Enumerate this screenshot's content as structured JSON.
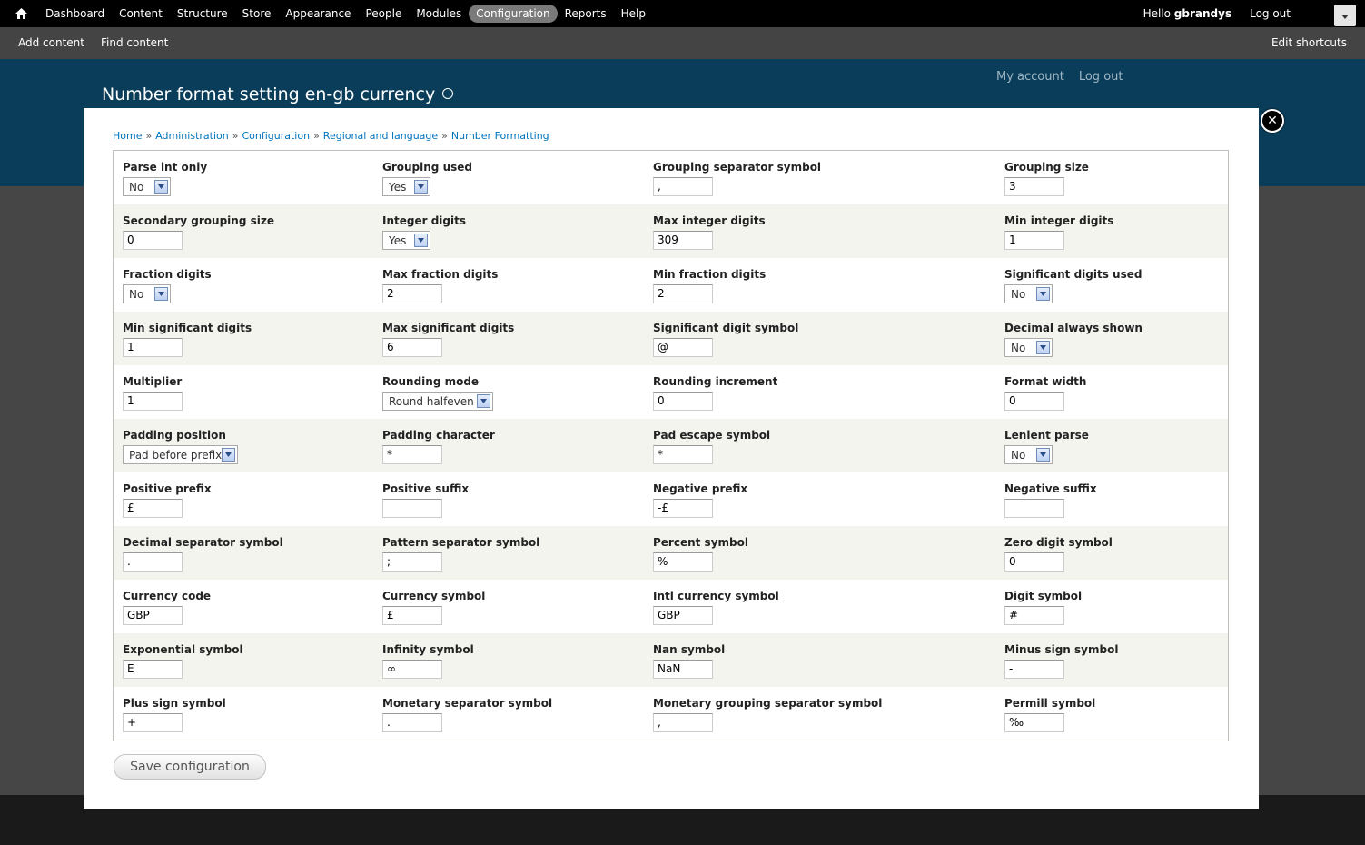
{
  "toolbar": {
    "menu": [
      "Dashboard",
      "Content",
      "Structure",
      "Store",
      "Appearance",
      "People",
      "Modules",
      "Configuration",
      "Reports",
      "Help"
    ],
    "active": "Configuration",
    "hello_prefix": "Hello ",
    "username": "gbrandys",
    "logout": "Log out"
  },
  "shortcuts": {
    "links": [
      "Add content",
      "Find content"
    ],
    "edit": "Edit shortcuts"
  },
  "page": {
    "title": "Number format setting en-gb currency",
    "secondary": [
      "My account",
      "Log out"
    ]
  },
  "breadcrumb": [
    "Home",
    "Administration",
    "Configuration",
    "Regional and language",
    "Number Formatting"
  ],
  "rows": [
    [
      {
        "label": "Parse int only",
        "type": "select",
        "value": "No"
      },
      {
        "label": "Grouping used",
        "type": "select",
        "value": "Yes"
      },
      {
        "label": "Grouping separator symbol",
        "type": "text",
        "value": ","
      },
      {
        "label": "Grouping size",
        "type": "text",
        "value": "3"
      }
    ],
    [
      {
        "label": "Secondary grouping size",
        "type": "text",
        "value": "0"
      },
      {
        "label": "Integer digits",
        "type": "select",
        "value": "Yes"
      },
      {
        "label": "Max integer digits",
        "type": "text",
        "value": "309"
      },
      {
        "label": "Min integer digits",
        "type": "text",
        "value": "1"
      }
    ],
    [
      {
        "label": "Fraction digits",
        "type": "select",
        "value": "No"
      },
      {
        "label": "Max fraction digits",
        "type": "text",
        "value": "2"
      },
      {
        "label": "Min fraction digits",
        "type": "text",
        "value": "2"
      },
      {
        "label": "Significant digits used",
        "type": "select",
        "value": "No"
      }
    ],
    [
      {
        "label": "Min significant digits",
        "type": "text",
        "value": "1"
      },
      {
        "label": "Max significant digits",
        "type": "text",
        "value": "6"
      },
      {
        "label": "Significant digit symbol",
        "type": "text",
        "value": "@"
      },
      {
        "label": "Decimal always shown",
        "type": "select",
        "value": "No"
      }
    ],
    [
      {
        "label": "Multiplier",
        "type": "text",
        "value": "1"
      },
      {
        "label": "Rounding mode",
        "type": "select",
        "value": "Round halfeven"
      },
      {
        "label": "Rounding increment",
        "type": "text",
        "value": "0"
      },
      {
        "label": "Format width",
        "type": "text",
        "value": "0"
      }
    ],
    [
      {
        "label": "Padding position",
        "type": "select",
        "value": "Pad before prefix"
      },
      {
        "label": "Padding character",
        "type": "text",
        "value": "*"
      },
      {
        "label": "Pad escape symbol",
        "type": "text",
        "value": "*"
      },
      {
        "label": "Lenient parse",
        "type": "select",
        "value": "No"
      }
    ],
    [
      {
        "label": "Positive prefix",
        "type": "text",
        "value": "£"
      },
      {
        "label": "Positive suffix",
        "type": "text",
        "value": ""
      },
      {
        "label": "Negative prefix",
        "type": "text",
        "value": "-£"
      },
      {
        "label": "Negative suffix",
        "type": "text",
        "value": ""
      }
    ],
    [
      {
        "label": "Decimal separator symbol",
        "type": "text",
        "value": "."
      },
      {
        "label": "Pattern separator symbol",
        "type": "text",
        "value": ";"
      },
      {
        "label": "Percent symbol",
        "type": "text",
        "value": "%"
      },
      {
        "label": "Zero digit symbol",
        "type": "text",
        "value": "0"
      }
    ],
    [
      {
        "label": "Currency code",
        "type": "text",
        "value": "GBP"
      },
      {
        "label": "Currency symbol",
        "type": "text",
        "value": "£"
      },
      {
        "label": "Intl currency symbol",
        "type": "text",
        "value": "GBP"
      },
      {
        "label": "Digit symbol",
        "type": "text",
        "value": "#"
      }
    ],
    [
      {
        "label": "Exponential symbol",
        "type": "text",
        "value": "E"
      },
      {
        "label": "Infinity symbol",
        "type": "text",
        "value": "∞"
      },
      {
        "label": "Nan symbol",
        "type": "text",
        "value": "NaN"
      },
      {
        "label": "Minus sign symbol",
        "type": "text",
        "value": "-"
      }
    ],
    [
      {
        "label": "Plus sign symbol",
        "type": "text",
        "value": "+"
      },
      {
        "label": "Monetary separator symbol",
        "type": "text",
        "value": "."
      },
      {
        "label": "Monetary grouping separator symbol",
        "type": "text",
        "value": ","
      },
      {
        "label": "Permill symbol",
        "type": "text",
        "value": "‰"
      }
    ]
  ],
  "save_label": "Save configuration"
}
